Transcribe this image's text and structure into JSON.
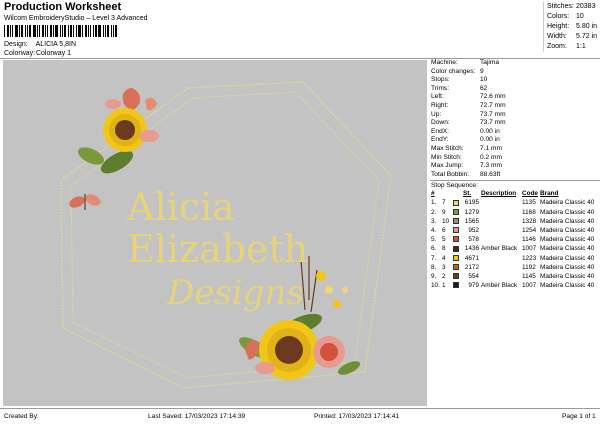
{
  "header": {
    "title": "Production Worksheet",
    "subtitle": "Wilcom EmbroideryStudio – Level 3 Advanced",
    "design_label": "Design:",
    "design_value": "ALICIA 5,8IN",
    "colorway_label": "Colorway:",
    "colorway_value": "Colorway 1"
  },
  "summary": [
    {
      "label": "Stitches:",
      "value": "20383"
    },
    {
      "label": "Colors:",
      "value": "10"
    },
    {
      "label": "Height:",
      "value": "5.80 in"
    },
    {
      "label": "Width:",
      "value": "5.72 in"
    },
    {
      "label": "Zoom:",
      "value": "1:1"
    }
  ],
  "design_preview": {
    "line1": "Alicia",
    "line2": "Elizabeth",
    "script": "Designs",
    "background": "#c3c3c3",
    "text_color": "#e6d37a",
    "frame_color": "#e8dc8a"
  },
  "machine_info": [
    {
      "label": "Machine:",
      "value": "Tajima"
    },
    {
      "label": "Color changes:",
      "value": "9"
    },
    {
      "label": "Stops:",
      "value": "10"
    },
    {
      "label": "Trims:",
      "value": "62"
    },
    {
      "label": "Left:",
      "value": "72.6 mm"
    },
    {
      "label": "Right:",
      "value": "72.7 mm"
    },
    {
      "label": "Up:",
      "value": "73.7 mm"
    },
    {
      "label": "Down:",
      "value": "73.7 mm"
    },
    {
      "label": "EndX:",
      "value": "0.00 in"
    },
    {
      "label": "EndY:",
      "value": "0.00 in"
    },
    {
      "label": "Max Stitch:",
      "value": "7.1 mm"
    },
    {
      "label": "Min Stitch:",
      "value": "0.2 mm"
    },
    {
      "label": "Max Jump:",
      "value": "7.3 mm"
    },
    {
      "label": "Total Bobbin:",
      "value": "88.63ft"
    }
  ],
  "stop_sequence_label": "Stop Sequence:",
  "stop_headers": {
    "number": "#",
    "stitches": "St.",
    "description": "Description",
    "code": "Code",
    "brand": "Brand"
  },
  "stops": [
    {
      "no": "1.",
      "thread": "7",
      "color": "#f2d675",
      "stitches": "6195",
      "desc": "",
      "code": "1135",
      "brand": "Madeira Classic 40"
    },
    {
      "no": "2.",
      "thread": "9",
      "color": "#7aa13c",
      "stitches": "1279",
      "desc": "",
      "code": "1168",
      "brand": "Madeira Classic 40"
    },
    {
      "no": "3.",
      "thread": "10",
      "color": "#9b8a7a",
      "stitches": "1565",
      "desc": "",
      "code": "1328",
      "brand": "Madeira Classic 40"
    },
    {
      "no": "4.",
      "thread": "6",
      "color": "#e79b8f",
      "stitches": "952",
      "desc": "",
      "code": "1254",
      "brand": "Madeira Classic 40"
    },
    {
      "no": "5.",
      "thread": "5",
      "color": "#d2503c",
      "stitches": "578",
      "desc": "",
      "code": "1146",
      "brand": "Madeira Classic 40"
    },
    {
      "no": "6.",
      "thread": "8",
      "color": "#3a2a1a",
      "stitches": "1436",
      "desc": "Amber Black",
      "code": "1007",
      "brand": "Madeira Classic 40"
    },
    {
      "no": "7.",
      "thread": "4",
      "color": "#f0c619",
      "stitches": "4671",
      "desc": "",
      "code": "1223",
      "brand": "Madeira Classic 40"
    },
    {
      "no": "8.",
      "thread": "3",
      "color": "#b5651d",
      "stitches": "2172",
      "desc": "",
      "code": "1192",
      "brand": "Madeira Classic 40"
    },
    {
      "no": "9.",
      "thread": "2",
      "color": "#6b3a1e",
      "stitches": "554",
      "desc": "",
      "code": "1145",
      "brand": "Madeira Classic 40"
    },
    {
      "no": "10.",
      "thread": "1",
      "color": "#1a1a1a",
      "stitches": "979",
      "desc": "Amber Black",
      "code": "1007",
      "brand": "Madeira Classic 40"
    }
  ],
  "footer": {
    "created_by": "Created By:",
    "last_saved": "Last Saved: 17/03/2023 17:14:39",
    "printed": "Printed: 17/03/2023 17:14:41",
    "page": "Page 1 of 1"
  }
}
